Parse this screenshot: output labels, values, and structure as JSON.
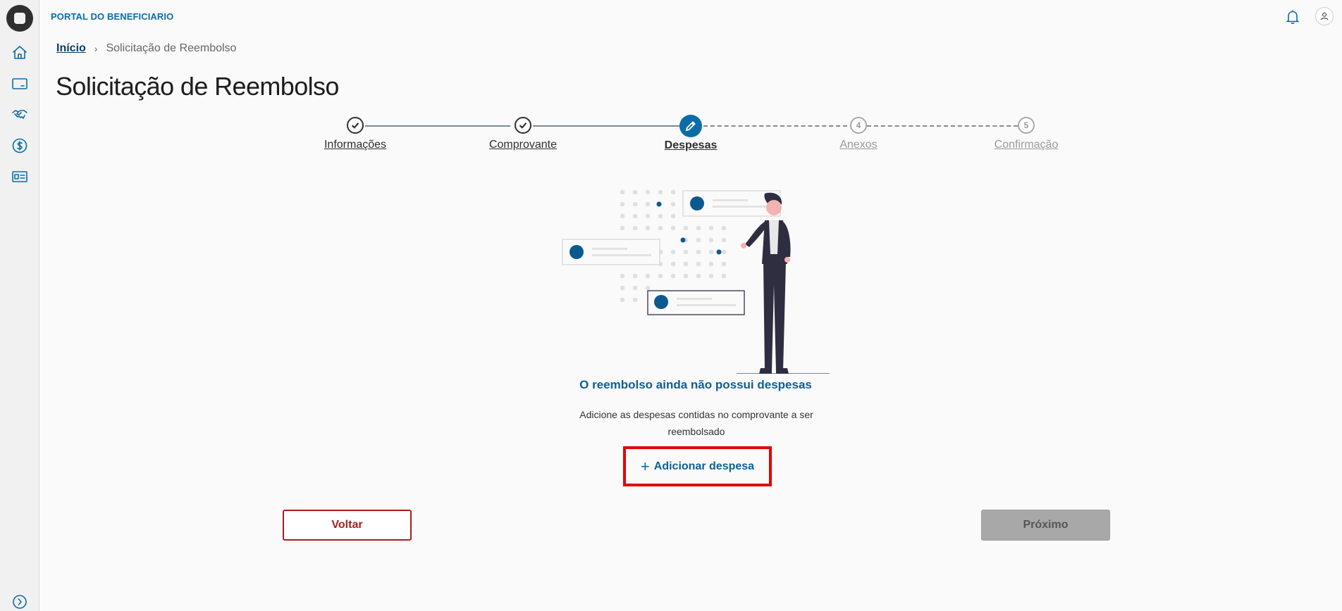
{
  "header": {
    "portal_title": "PORTAL DO BENEFICIARIO"
  },
  "sidebar": {
    "items": [
      {
        "icon": "home-icon"
      },
      {
        "icon": "card-icon"
      },
      {
        "icon": "handshake-icon"
      },
      {
        "icon": "dollar-circle-icon"
      },
      {
        "icon": "id-card-icon"
      }
    ],
    "expand_icon": "chevron-right-circle-icon"
  },
  "breadcrumb": {
    "home": "Início",
    "current": "Solicitação de Reembolso"
  },
  "page": {
    "title": "Solicitação de Reembolso"
  },
  "stepper": {
    "steps": [
      {
        "label": "Informações",
        "state": "done"
      },
      {
        "label": "Comprovante",
        "state": "done"
      },
      {
        "label": "Despesas",
        "state": "active"
      },
      {
        "label": "Anexos",
        "number": "4",
        "state": "pending"
      },
      {
        "label": "Confirmação",
        "number": "5",
        "state": "pending"
      }
    ]
  },
  "empty_state": {
    "title": "O reembolso ainda não possui despesas",
    "description": "Adicione as despesas contidas no comprovante a ser reembolsado",
    "add_button_label": "Adicionar despesa",
    "add_icon": "plus-icon"
  },
  "actions": {
    "back_label": "Voltar",
    "next_label": "Próximo"
  },
  "colors": {
    "primary": "#0c6ca7",
    "danger": "#a81d1d",
    "highlight": "#e60000",
    "disabled": "#a8a8a8"
  }
}
